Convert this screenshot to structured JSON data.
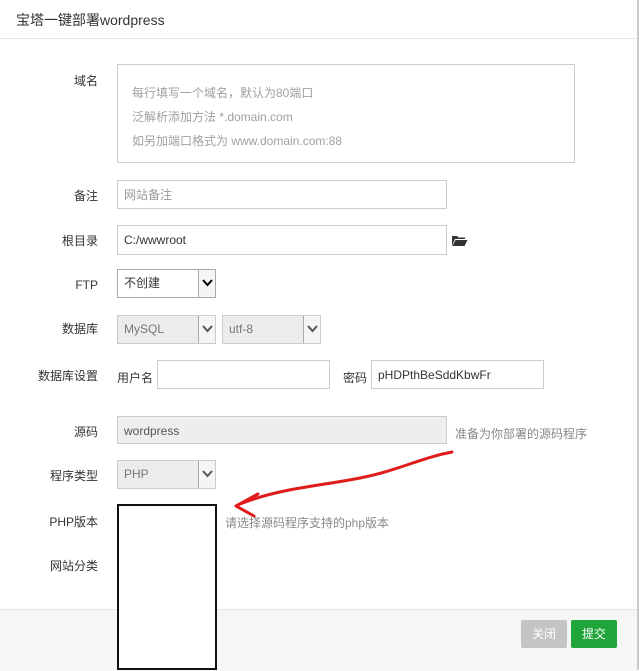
{
  "header": {
    "title": "宝塔一键部署wordpress"
  },
  "labels": {
    "domain": "域名",
    "note": "备注",
    "root": "根目录",
    "ftp": "FTP",
    "database": "数据库",
    "db_settings": "数据库设置",
    "source": "源码",
    "program_type": "程序类型",
    "php_version": "PHP版本",
    "site_category": "网站分类"
  },
  "domain_textarea": {
    "lines": [
      "每行填写一个域名，默认为80端口",
      "泛解析添加方法 *.domain.com",
      "如另加端口格式为 www.domain.com:88"
    ]
  },
  "note_input": {
    "placeholder": "网站备注"
  },
  "root_input": {
    "value": "C:/wwwroot"
  },
  "ftp_select": {
    "value": "不创建"
  },
  "db_select": {
    "value": "MySQL"
  },
  "charset_select": {
    "value": "utf-8"
  },
  "db_user": {
    "label": "用户名",
    "value": ""
  },
  "db_password": {
    "label": "密码",
    "value": "pHDPthBeSddKbwFr"
  },
  "source_input": {
    "value": "wordpress",
    "hint": "准备为你部署的源码程序"
  },
  "program_type_select": {
    "value": "PHP"
  },
  "php_version_hint": "请选择源码程序支持的php版本",
  "footer": {
    "close_label": "关闭",
    "submit_label": "提交"
  },
  "colors": {
    "submit": "#20a53a",
    "close": "#c4c4c4",
    "annotation": "#e01b1b"
  },
  "icons": {
    "folder": "folder-open-icon",
    "arrow": "chevron-down-icon"
  }
}
